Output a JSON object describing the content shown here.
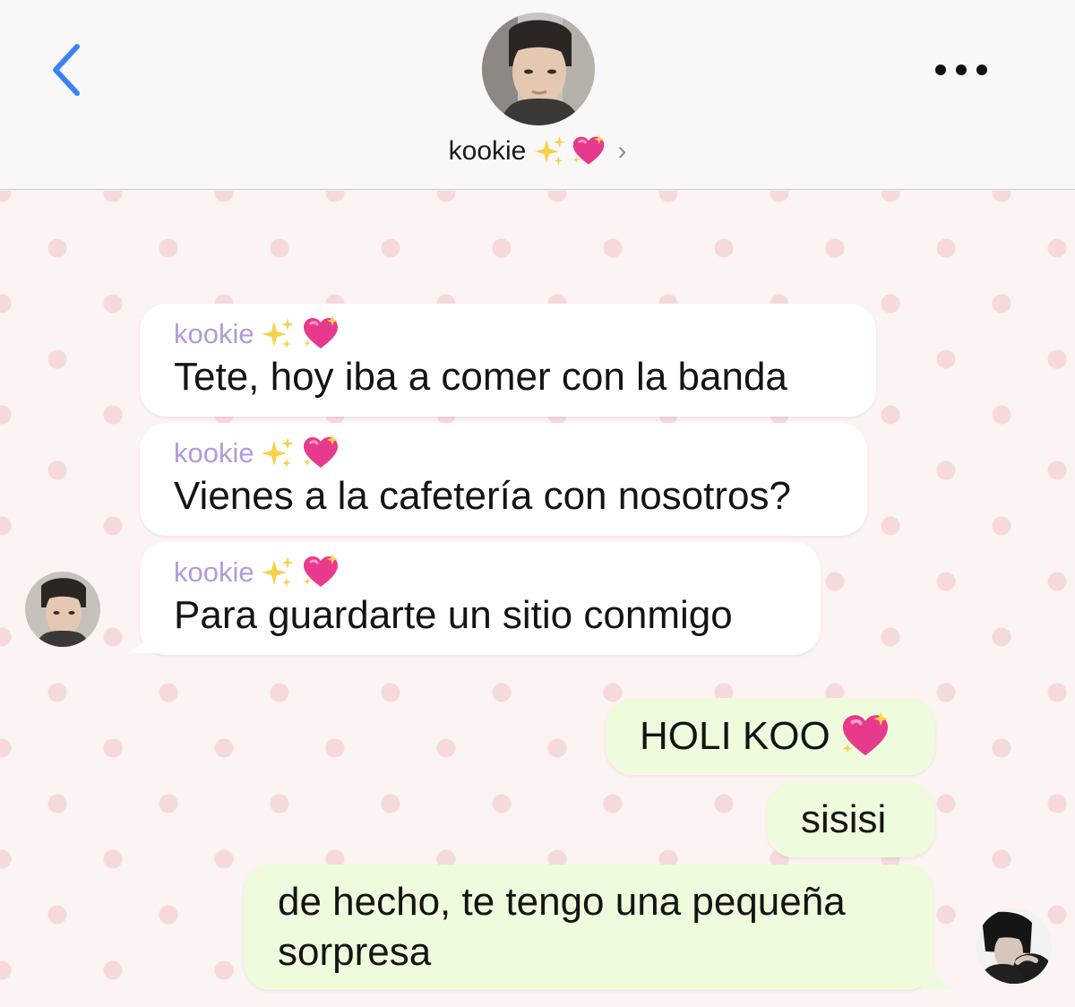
{
  "header": {
    "contact_name": "kookie",
    "contact_emoji": [
      "sparkles-emoji",
      "sparkling-heart-emoji"
    ]
  },
  "messages": [
    {
      "direction": "incoming",
      "sender": "kookie",
      "text": "Tete, hoy iba a comer con la banda"
    },
    {
      "direction": "incoming",
      "sender": "kookie",
      "text": "Vienes a la cafetería con nosotros?"
    },
    {
      "direction": "incoming",
      "sender": "kookie",
      "text": "Para guardarte un sitio conmigo"
    },
    {
      "direction": "outgoing",
      "text": "HOLI KOO",
      "emoji": "sparkling-heart-emoji"
    },
    {
      "direction": "outgoing",
      "text": "sisisi"
    },
    {
      "direction": "outgoing",
      "text": "de hecho, te tengo una pequeña sorpresa"
    }
  ],
  "colors": {
    "accent_blue": "#3a82f6",
    "incoming_bubble": "#ffffff",
    "outgoing_bubble": "#eefbdc",
    "sender_name": "#b39ad9",
    "polka_dot": "#f6d9db",
    "chat_background": "#fcf3f3"
  }
}
